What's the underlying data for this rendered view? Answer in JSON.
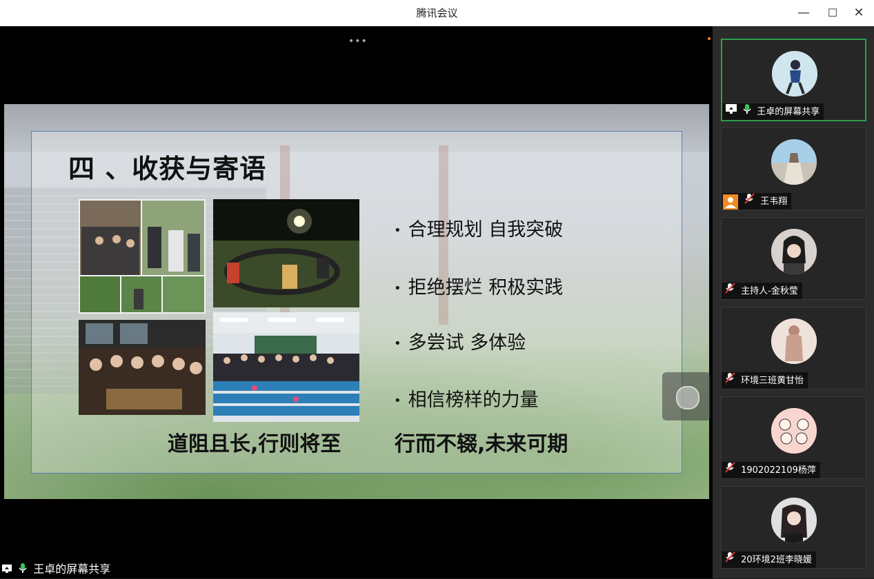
{
  "window": {
    "title": "腾讯会议",
    "minimize_glyph": "—",
    "maximize_glyph": "☐",
    "close_glyph": "✕"
  },
  "stage": {
    "dots": "•••",
    "share_label": "王卓的屏幕共享"
  },
  "slide": {
    "title": "四 、收获与寄语",
    "bullets": [
      "合理规划 自我突破",
      "拒绝摆烂 积极实践",
      "多尝试 多体验",
      "相信榜样的力量"
    ],
    "bullet_glyph": "•",
    "motto_left": "道阻且长,行则将至",
    "motto_right": "行而不辍,未来可期"
  },
  "participants": [
    {
      "name": "王卓的屏幕共享",
      "icons": [
        "screen-share-icon",
        "mic-on-icon"
      ],
      "active": true
    },
    {
      "name": "王韦翔",
      "icons": [
        "user-icon",
        "mic-muted-icon"
      ],
      "active": false
    },
    {
      "name": "主持人-金秋莹",
      "icons": [
        "mic-muted-icon"
      ],
      "active": false
    },
    {
      "name": "环境三班黄甘怡",
      "icons": [
        "mic-muted-icon"
      ],
      "active": false
    },
    {
      "name": "1902022109杨萍",
      "icons": [
        "mic-muted-icon"
      ],
      "active": false
    },
    {
      "name": "20环境2班李晓媛",
      "icons": [
        "mic-muted-icon"
      ],
      "active": false
    }
  ],
  "colors": {
    "active_border": "#2aa04a",
    "mic_on": "#34c759",
    "user_icon_bg": "#f08a1e",
    "frame_border": "#5a7fb8"
  }
}
